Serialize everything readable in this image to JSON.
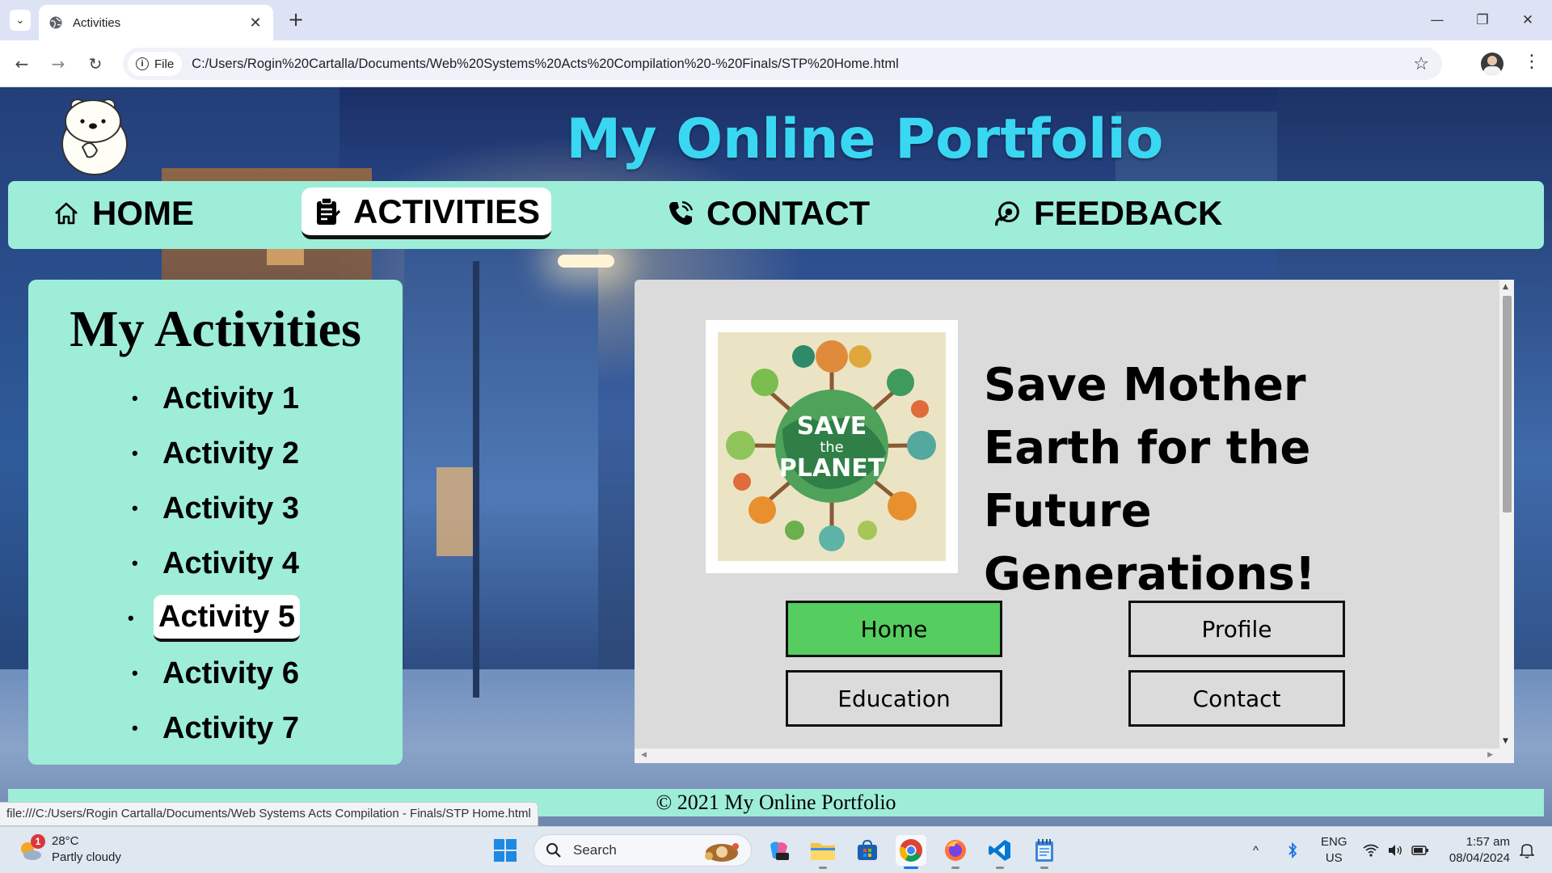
{
  "browser": {
    "tab_title": "Activities",
    "site_chip": "File",
    "url": "C:/Users/Rogin%20Cartalla/Documents/Web%20Systems%20Acts%20Compilation%20-%20Finals/STP%20Home.html"
  },
  "page": {
    "site_title": "My Online Portfolio",
    "nav": [
      {
        "label": "HOME",
        "icon": "home-icon"
      },
      {
        "label": "ACTIVITIES",
        "icon": "clipboard-icon",
        "active": true
      },
      {
        "label": "CONTACT",
        "icon": "phone-icon"
      },
      {
        "label": "FEEDBACK",
        "icon": "feedback-icon"
      }
    ],
    "sidebar": {
      "title": "My Activities",
      "items": [
        "Activity 1",
        "Activity 2",
        "Activity 3",
        "Activity 4",
        "Activity 5",
        "Activity 6",
        "Activity 7"
      ],
      "active_index": 4
    },
    "content": {
      "poster_text_1": "SAVE",
      "poster_text_2": "the",
      "poster_text_3": "PLANET",
      "headline": "Save Mother Earth for the Future Generations!",
      "buttons": [
        "Home",
        "Profile",
        "Education",
        "Contact"
      ],
      "highlight_button": "Home",
      "highlight_color": "#55cd5f"
    },
    "footer": "© 2021 My Online Portfolio",
    "status_url": "file:///C:/Users/Rogin Cartalla/Documents/Web Systems Acts Compilation - Finals/STP Home.html",
    "accent_color": "#9eedd8",
    "title_color": "#3ad7f2"
  },
  "taskbar": {
    "weather_badge": "1",
    "temperature": "28°C",
    "condition": "Partly cloudy",
    "search_placeholder": "Search",
    "lang_1": "ENG",
    "lang_2": "US",
    "time": "1:57 am",
    "date": "08/04/2024"
  }
}
